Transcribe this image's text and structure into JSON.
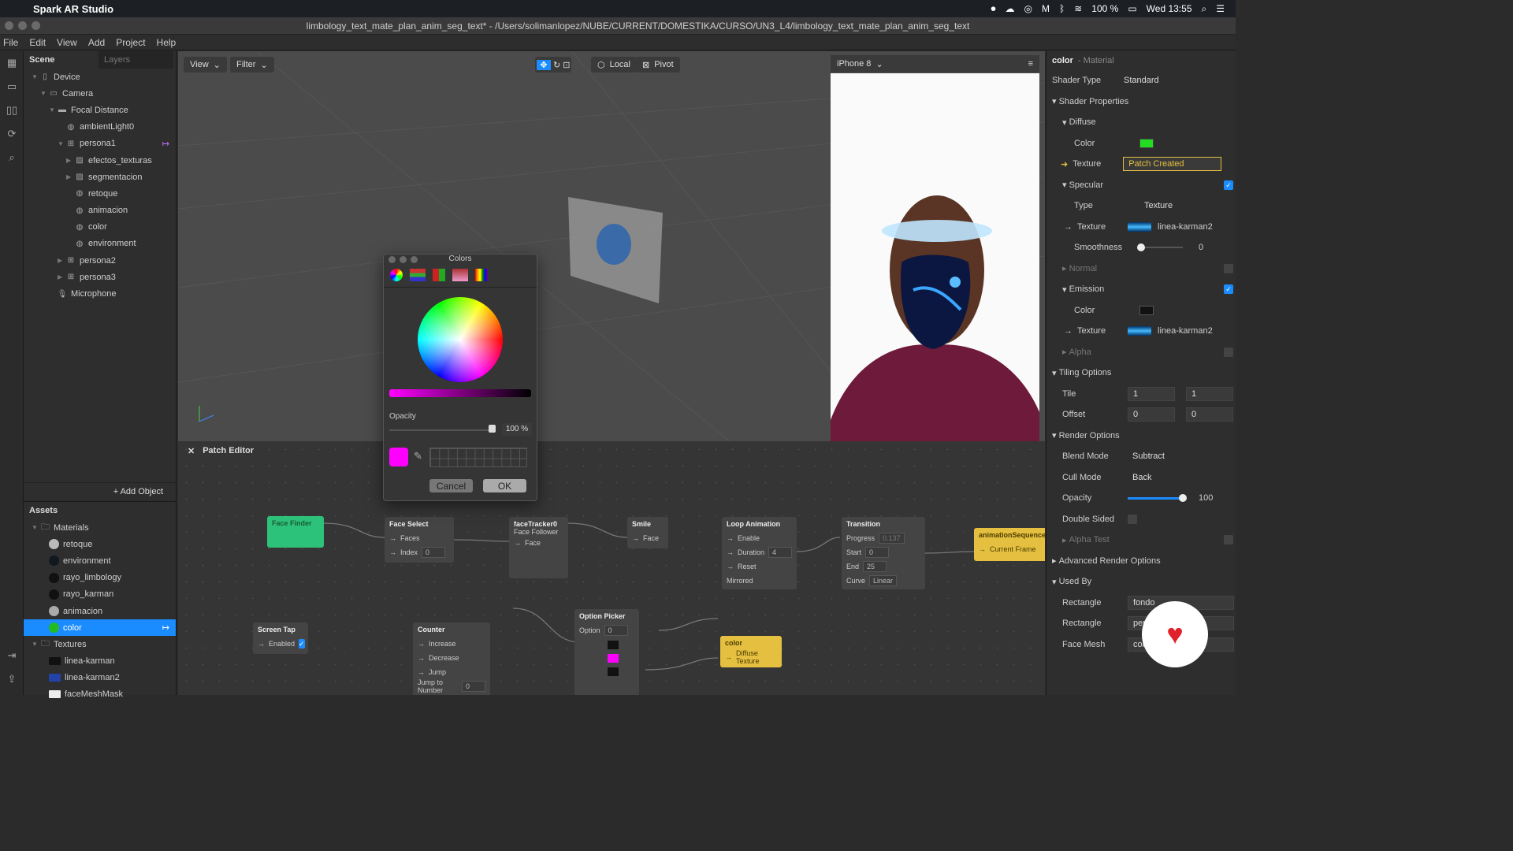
{
  "mac_menubar": {
    "app_name": "Spark AR Studio",
    "battery": "100 %",
    "clock": "Wed 13:55"
  },
  "window": {
    "title": "limbology_text_mate_plan_anim_seg_text* - /Users/solimanlopez/NUBE/CURRENT/DOMESTIKA/CURSO/UN3_L4/limbology_text_mate_plan_anim_seg_text"
  },
  "app_menu": [
    "File",
    "Edit",
    "View",
    "Add",
    "Project",
    "Help"
  ],
  "scene_panel": {
    "tabs": [
      "Scene",
      "Layers"
    ],
    "tree": [
      {
        "label": "Device",
        "depth": 0,
        "icon": "device-icon",
        "arrow": "▼"
      },
      {
        "label": "Camera",
        "depth": 1,
        "icon": "camera-icon",
        "arrow": "▼"
      },
      {
        "label": "Focal Distance",
        "depth": 2,
        "icon": "ruler-icon",
        "arrow": "▼"
      },
      {
        "label": "ambientLight0",
        "depth": 3,
        "icon": "light-icon",
        "arrow": ""
      },
      {
        "label": "persona1",
        "depth": 3,
        "icon": "face-tracker-icon",
        "arrow": "▼"
      },
      {
        "label": "efectos_texturas",
        "depth": 4,
        "icon": "plane-icon",
        "arrow": "▶"
      },
      {
        "label": "segmentacion",
        "depth": 4,
        "icon": "plane-icon",
        "arrow": "▶"
      },
      {
        "label": "retoque",
        "depth": 4,
        "icon": "mesh-icon",
        "arrow": ""
      },
      {
        "label": "animacion",
        "depth": 4,
        "icon": "mesh-icon",
        "arrow": ""
      },
      {
        "label": "color",
        "depth": 4,
        "icon": "mesh-icon",
        "arrow": ""
      },
      {
        "label": "environment",
        "depth": 4,
        "icon": "mesh-icon",
        "arrow": ""
      },
      {
        "label": "persona2",
        "depth": 3,
        "icon": "face-tracker-icon",
        "arrow": "▶"
      },
      {
        "label": "persona3",
        "depth": 3,
        "icon": "face-tracker-icon",
        "arrow": "▶"
      },
      {
        "label": "Microphone",
        "depth": 2,
        "icon": "microphone-icon",
        "arrow": ""
      }
    ],
    "add_object": "+ Add Object"
  },
  "assets_panel": {
    "title": "Assets",
    "items": [
      {
        "label": "Materials",
        "type": "folder",
        "arrow": "▼"
      },
      {
        "label": "retoque",
        "type": "material",
        "color": "#bbbbbb"
      },
      {
        "label": "environment",
        "type": "material",
        "color": "#111820"
      },
      {
        "label": "rayo_limbology",
        "type": "material",
        "color": "#111"
      },
      {
        "label": "rayo_karman",
        "type": "material",
        "color": "#111"
      },
      {
        "label": "animacion",
        "type": "material",
        "color": "#aaaaaa"
      },
      {
        "label": "color",
        "type": "material",
        "color": "#22bb22",
        "selected": true
      },
      {
        "label": "Textures",
        "type": "folder",
        "arrow": "▼"
      },
      {
        "label": "linea-karman",
        "type": "texture",
        "color": "#111"
      },
      {
        "label": "linea-karman2",
        "type": "texture",
        "color": "#2244aa"
      },
      {
        "label": "faceMeshMask",
        "type": "texture",
        "color": "#eee"
      }
    ]
  },
  "viewport": {
    "view_label": "View",
    "filter_label": "Filter",
    "local_label": "Local",
    "pivot_label": "Pivot",
    "device": "iPhone 8"
  },
  "colors_dialog": {
    "title": "Colors",
    "opacity_label": "Opacity",
    "opacity_value": "100 %",
    "current_color": "#ff00ff",
    "cancel": "Cancel",
    "ok": "OK"
  },
  "patch_editor": {
    "title": "Patch Editor",
    "nodes": {
      "face_finder": {
        "title": "Face Finder"
      },
      "face_select": {
        "title": "Face Select",
        "faces": "Faces",
        "index_label": "Index",
        "index_value": "0"
      },
      "face_tracker": {
        "title": "faceTracker0",
        "subtitle": "Face Follower",
        "face": "Face"
      },
      "smile": {
        "title": "Smile",
        "face": "Face"
      },
      "loop_animation": {
        "title": "Loop Animation",
        "enable": "Enable",
        "duration_label": "Duration",
        "duration_value": "4",
        "reset": "Reset",
        "mirrored": "Mirrored"
      },
      "transition": {
        "title": "Transition",
        "progress_label": "Progress",
        "progress_value": "0.137",
        "start_label": "Start",
        "start_value": "0",
        "end_label": "End",
        "end_value": "25",
        "curve_label": "Curve",
        "curve_value": "Linear"
      },
      "animation_sequence": {
        "title": "animationSequence",
        "current_frame": "Current Frame"
      },
      "screen_tap": {
        "title": "Screen Tap",
        "enabled": "Enabled"
      },
      "counter": {
        "title": "Counter",
        "increase": "Increase",
        "decrease": "Decrease",
        "jump": "Jump",
        "jump_to_label": "Jump to Number",
        "jump_to_value": "0"
      },
      "option_picker": {
        "title": "Option Picker",
        "option_label": "Option",
        "option_value": "0"
      },
      "color_node": {
        "title": "color",
        "port": "Diffuse Texture"
      }
    }
  },
  "inspector": {
    "title": "color",
    "subtitle": "- Material",
    "shader_type_label": "Shader Type",
    "shader_type_value": "Standard",
    "shader_properties": "Shader Properties",
    "diffuse": "Diffuse",
    "diffuse_color_label": "Color",
    "diffuse_color": "#22dd22",
    "diffuse_texture_label": "Texture",
    "diffuse_texture_value": "Patch Created",
    "specular": "Specular",
    "specular_type_label": "Type",
    "specular_type_value": "Texture",
    "specular_texture_label": "Texture",
    "specular_texture_value": "linea-karman2",
    "smoothness_label": "Smoothness",
    "smoothness_value": "0",
    "normal": "Normal",
    "emission": "Emission",
    "emission_color_label": "Color",
    "emission_color": "#111111",
    "emission_texture_label": "Texture",
    "emission_texture_value": "linea-karman2",
    "alpha": "Alpha",
    "tiling_options": "Tiling Options",
    "tile_label": "Tile",
    "tile_x": "1",
    "tile_y": "1",
    "offset_label": "Offset",
    "offset_x": "0",
    "offset_y": "0",
    "render_options": "Render Options",
    "blend_mode_label": "Blend Mode",
    "blend_mode_value": "Subtract",
    "cull_mode_label": "Cull Mode",
    "cull_mode_value": "Back",
    "opacity_label": "Opacity",
    "opacity_value": "100",
    "double_sided": "Double Sided",
    "alpha_test": "Alpha Test",
    "advanced_render_options": "Advanced Render Options",
    "used_by": "Used By",
    "used_by_items": [
      {
        "label": "Rectangle",
        "value": "fondo"
      },
      {
        "label": "Rectangle",
        "value": "pers"
      },
      {
        "label": "Face Mesh",
        "value": "colo"
      }
    ]
  }
}
